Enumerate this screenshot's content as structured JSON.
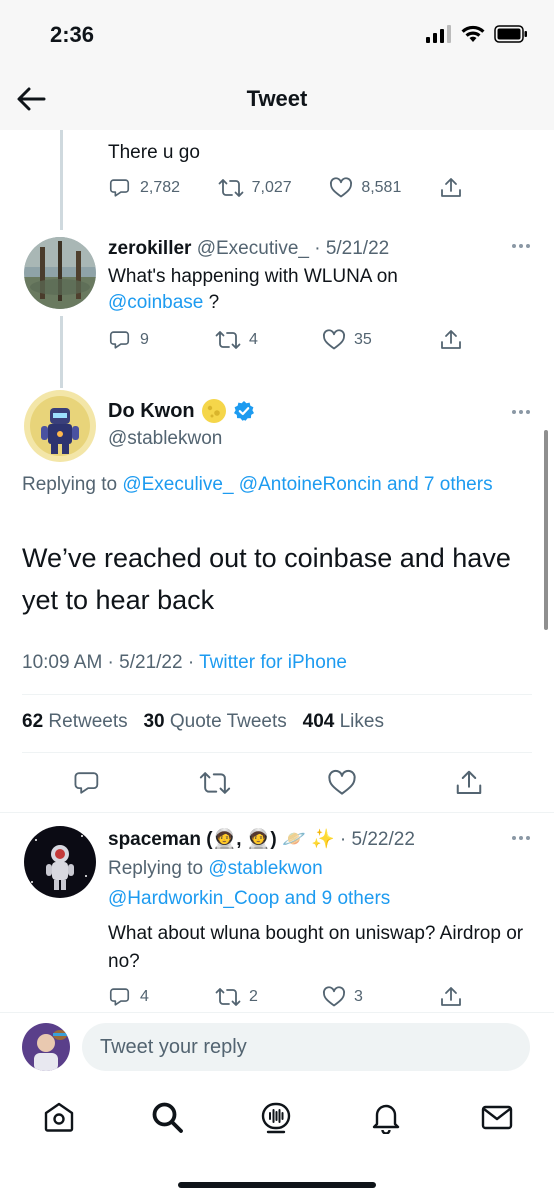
{
  "status_bar": {
    "time": "2:36"
  },
  "header": {
    "title": "Tweet"
  },
  "prev_tweet": {
    "text": "There u go",
    "replies": "2,782",
    "retweets": "7,027",
    "likes": "8,581"
  },
  "reply1": {
    "name": "zerokiller",
    "handle_date": "@Executive_ · 5/21/22",
    "text": "What's happening with WLUNA on",
    "mention": "@coinbase",
    "text_after": " ?",
    "replies": "9",
    "retweets": "4",
    "likes": "35"
  },
  "main_tweet": {
    "name": "Do Kwon",
    "handle": "@stablekwon",
    "replying_prefix": "Replying to",
    "replying_to": "@Execulive_ @AntoineRoncin and 7 others",
    "text": "We’ve reached out to coinbase and have yet to hear back",
    "time": "10:09 AM · 5/21/22 · ",
    "source": "Twitter for iPhone",
    "retweets_count": "62",
    "retweets_label": " Retweets",
    "quotes_count": "30",
    "quotes_label": " Quote Tweets",
    "likes_count": "404",
    "likes_label": " Likes"
  },
  "reply2": {
    "name": "spaceman (🧑‍🚀, 🧑‍🚀) 🪐 ✨",
    "date": " · 5/22/22",
    "replying_prefix": "Replying to ",
    "replying_line1": "@stablekwon",
    "replying_line2": "@Hardworkin_Coop and 9 others",
    "text": "What about wluna bought on uniswap? Airdrop or no?",
    "replies": "4",
    "retweets": "2",
    "likes": "3"
  },
  "compose": {
    "placeholder": "Tweet your reply"
  },
  "colors": {
    "accent": "#1d9bf0",
    "muted": "#536471",
    "verified": "#1d9bf0"
  },
  "icons": [
    "back-arrow-icon",
    "reply-icon",
    "retweet-icon",
    "like-icon",
    "share-icon",
    "verified-icon",
    "home-icon",
    "search-icon",
    "spaces-icon",
    "notifications-icon",
    "messages-icon"
  ]
}
